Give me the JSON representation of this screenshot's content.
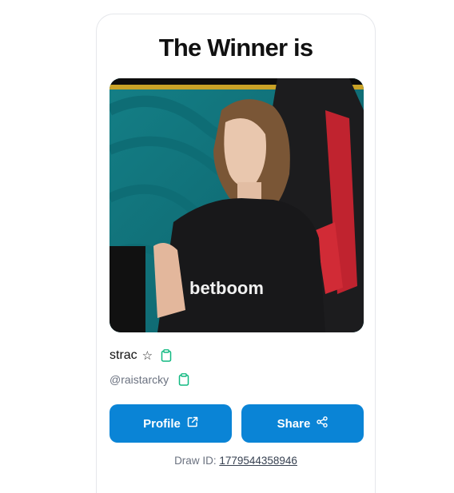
{
  "header": {
    "title": "The Winner is"
  },
  "winner": {
    "name": "strac",
    "star_glyph": "☆",
    "handle": "@raistarcky",
    "photo_icon": "winner-photo"
  },
  "actions": {
    "profile_label": "Profile",
    "share_label": "Share"
  },
  "draw": {
    "label": "Draw ID:",
    "id": "1779544358946"
  },
  "colors": {
    "accent": "#0a84d6",
    "copy_icon": "#10b981",
    "muted_text": "#6b7280"
  },
  "icons": [
    "clipboard-icon",
    "external-link-icon",
    "share-icon",
    "star-icon"
  ]
}
